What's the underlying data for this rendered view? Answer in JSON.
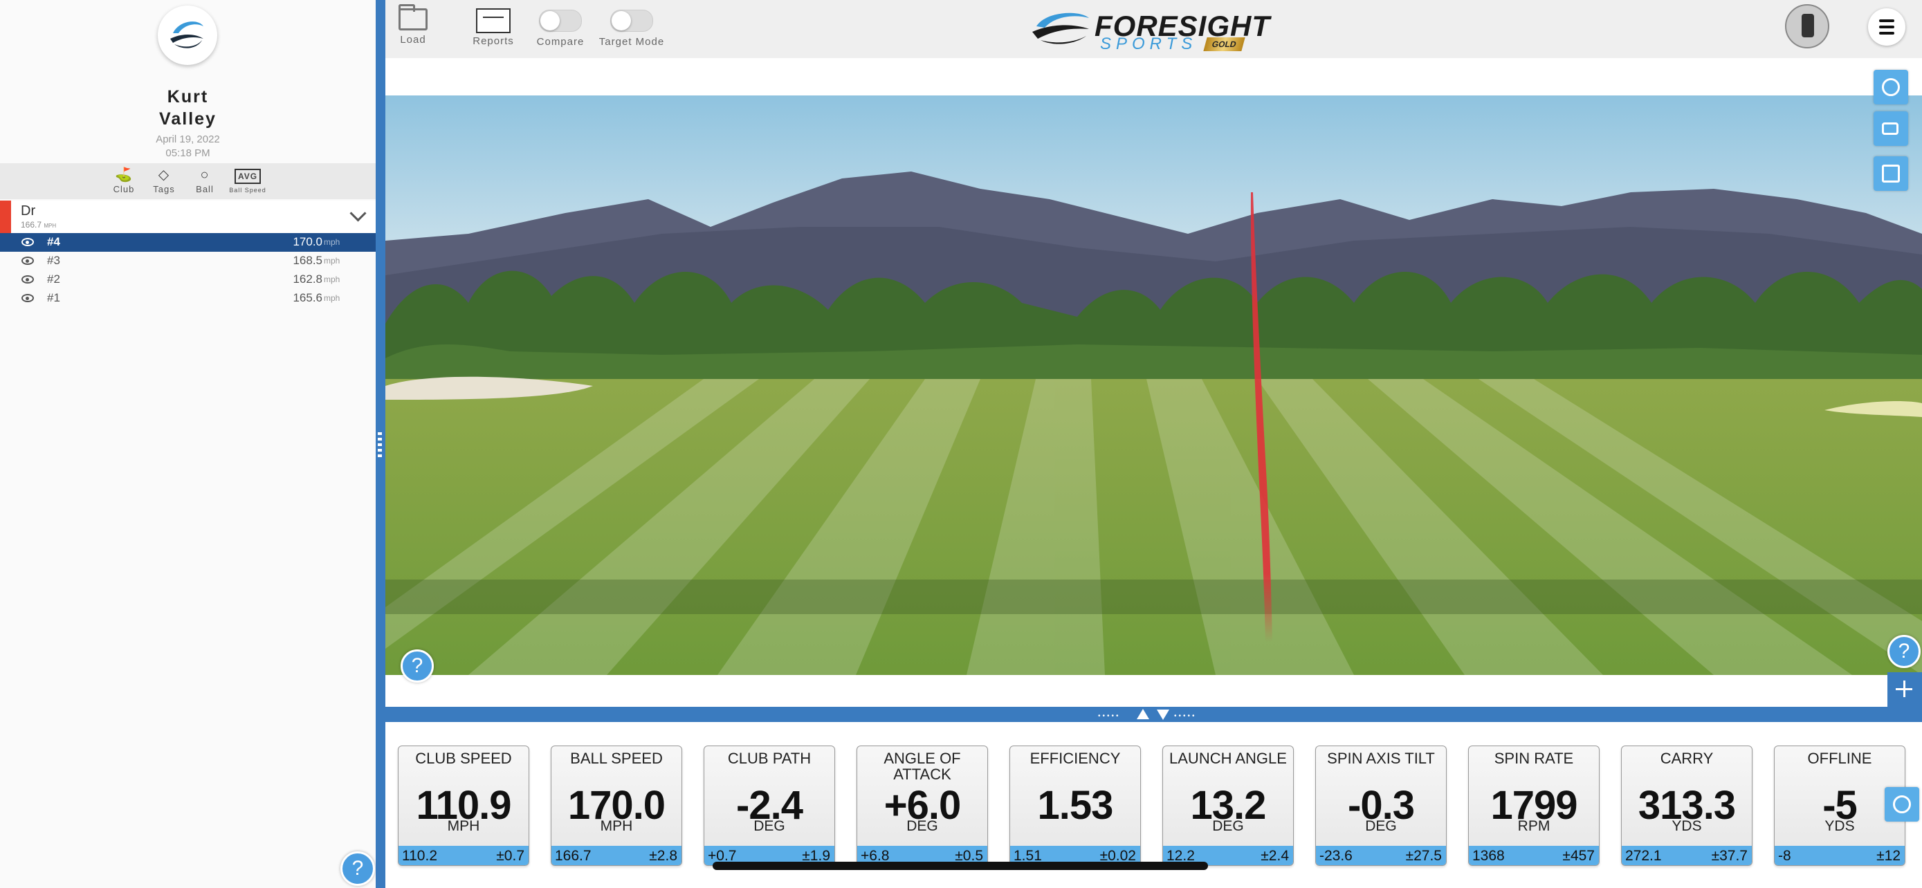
{
  "sidebar": {
    "user_first": "Kurt",
    "user_last": "Valley",
    "date": "April 19, 2022",
    "time": "05:18 PM",
    "tools": [
      {
        "label": "Club",
        "icon": "club-icon"
      },
      {
        "label": "Tags",
        "icon": "tag-icon"
      },
      {
        "label": "Ball",
        "icon": "ball-icon"
      },
      {
        "label": "Ball Speed",
        "icon": "avg-icon",
        "badge": "AVG"
      }
    ],
    "club": {
      "name": "Dr",
      "avg": "166.7",
      "avg_unit": "MPH",
      "marker_color": "#e8412e"
    },
    "shots": [
      {
        "num": "#4",
        "value": "170.0",
        "unit": "mph",
        "selected": true
      },
      {
        "num": "#3",
        "value": "168.5",
        "unit": "mph",
        "selected": false
      },
      {
        "num": "#2",
        "value": "162.8",
        "unit": "mph",
        "selected": false
      },
      {
        "num": "#1",
        "value": "165.6",
        "unit": "mph",
        "selected": false
      }
    ]
  },
  "toolbar": {
    "load_label": "Load",
    "reports_label": "Reports",
    "compare_label": "Compare",
    "target_mode_label": "Target Mode",
    "brand_main": "FORESIGHT",
    "brand_sub": "SPORTS",
    "brand_tier": "GOLD"
  },
  "help_glyph": "?",
  "metrics": [
    {
      "label": "CLUB SPEED",
      "value": "110.9",
      "unit": "MPH",
      "avg": "110.2",
      "sd": "±0.7"
    },
    {
      "label": "BALL SPEED",
      "value": "170.0",
      "unit": "MPH",
      "avg": "166.7",
      "sd": "±2.8"
    },
    {
      "label": "CLUB PATH",
      "value": "-2.4",
      "unit": "DEG",
      "avg": "+0.7",
      "sd": "±1.9"
    },
    {
      "label": "ANGLE OF ATTACK",
      "value": "+6.0",
      "unit": "DEG",
      "avg": "+6.8",
      "sd": "±0.5"
    },
    {
      "label": "EFFICIENCY",
      "value": "1.53",
      "unit": "",
      "avg": "1.51",
      "sd": "±0.02"
    },
    {
      "label": "LAUNCH ANGLE",
      "value": "13.2",
      "unit": "DEG",
      "avg": "12.2",
      "sd": "±2.4"
    },
    {
      "label": "SPIN AXIS TILT",
      "value": "-0.3",
      "unit": "DEG",
      "avg": "-23.6",
      "sd": "±27.5"
    },
    {
      "label": "SPIN RATE",
      "value": "1799",
      "unit": "RPM",
      "avg": "1368",
      "sd": "±457"
    },
    {
      "label": "CARRY",
      "value": "313.3",
      "unit": "YDS",
      "avg": "272.1",
      "sd": "±37.7"
    },
    {
      "label": "OFFLINE",
      "value": "-5",
      "unit": "YDS",
      "avg": "-8",
      "sd": "±12"
    }
  ],
  "colors": {
    "accent": "#3a7bbf",
    "tile_footer": "#5aaee8",
    "selected_row": "#1f4f8c",
    "shot_tracer": "#e0323a"
  }
}
